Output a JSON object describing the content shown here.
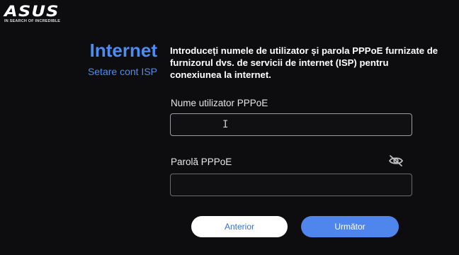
{
  "brand": {
    "logo_text": "ASUS",
    "tagline": "IN SEARCH OF INCREDIBLE"
  },
  "header": {
    "title": "Internet",
    "subtitle": "Setare cont ISP"
  },
  "instructions": "Introduceți numele de utilizator și parola PPPoE furnizate de furnizorul dvs. de servicii de internet (ISP) pentru conexiunea la internet.",
  "form": {
    "username_label": "Nume utilizator PPPoE",
    "username_value": "",
    "password_label": "Parolă PPPoE",
    "password_value": "",
    "password_toggle_icon": "eye-slash-icon"
  },
  "buttons": {
    "back_label": "Anterior",
    "next_label": "Următor"
  },
  "colors": {
    "accent": "#4d8df2",
    "background": "#0d0d0f",
    "next_button": "#4f86ee",
    "back_button": "#ffffff"
  }
}
